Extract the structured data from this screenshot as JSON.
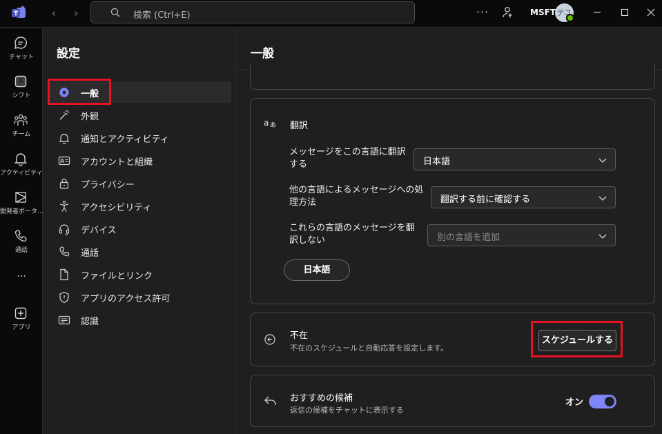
{
  "titlebar": {
    "search_placeholder": "検索 (Ctrl+E)",
    "more": "···",
    "org": "MSFT",
    "avatar_initials": "テユ"
  },
  "rail": {
    "items": [
      {
        "label": "チャット",
        "icon": "chat-icon"
      },
      {
        "label": "シフト",
        "icon": "shifts-icon"
      },
      {
        "label": "チーム",
        "icon": "teams-icon"
      },
      {
        "label": "アクティビティ",
        "icon": "bell-icon"
      },
      {
        "label": "開発者ポータ...",
        "icon": "developer-portal-icon"
      },
      {
        "label": "通話",
        "icon": "phone-icon"
      },
      {
        "label": "···",
        "icon": "more-icon"
      },
      {
        "label": "アプリ",
        "icon": "apps-icon"
      }
    ]
  },
  "settings": {
    "title": "設定",
    "menu": [
      {
        "label": "一般",
        "icon": "gear-icon",
        "selected": true
      },
      {
        "label": "外観",
        "icon": "wand-icon"
      },
      {
        "label": "通知とアクティビティ",
        "icon": "bell-icon"
      },
      {
        "label": "アカウントと組織",
        "icon": "id-card-icon"
      },
      {
        "label": "プライバシー",
        "icon": "lock-icon"
      },
      {
        "label": "アクセシビリティ",
        "icon": "accessibility-icon"
      },
      {
        "label": "デバイス",
        "icon": "headset-icon"
      },
      {
        "label": "通話",
        "icon": "phone-icon"
      },
      {
        "label": "ファイルとリンク",
        "icon": "file-icon"
      },
      {
        "label": "アプリのアクセス許可",
        "icon": "shield-icon"
      },
      {
        "label": "認識",
        "icon": "recognition-icon"
      }
    ]
  },
  "main": {
    "title": "一般",
    "translation": {
      "heading": "翻訳",
      "row1_label": "メッセージをこの言語に翻訳する",
      "row1_value": "日本語",
      "row2_label": "他の言語によるメッセージへの処理方法",
      "row2_value": "翻訳する前に確認する",
      "row3_label": "これらの言語のメッセージを翻訳しない",
      "row3_placeholder": "別の言語を追加",
      "chip": "日本語"
    },
    "away": {
      "title": "不在",
      "subtitle": "不在のスケジュールと自動応答を設定します。",
      "button": "スケジュールする"
    },
    "suggestions": {
      "title": "おすすめの候補",
      "subtitle": "返信の候補をチャットに表示する",
      "toggle_label": "オン",
      "enabled": true
    }
  },
  "colors": {
    "accent": "#7f85f5",
    "highlight_box": "#e81123",
    "background": "#1f1f1f",
    "status_available": "#6bb700"
  }
}
